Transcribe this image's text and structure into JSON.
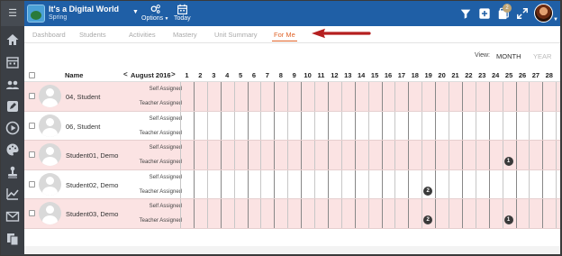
{
  "app": {
    "course_title": "It's a Digital World",
    "course_term": "Spring",
    "options_label": "Options",
    "today_label": "Today",
    "notification_count": "2"
  },
  "sidebar": {
    "items": [
      {
        "name": "home-icon"
      },
      {
        "name": "calendar-icon"
      },
      {
        "name": "users-icon"
      },
      {
        "name": "pencil-icon"
      },
      {
        "name": "play-icon"
      },
      {
        "name": "palette-icon"
      },
      {
        "name": "stamp-icon"
      },
      {
        "name": "chart-icon"
      },
      {
        "name": "mail-icon"
      },
      {
        "name": "pages-icon"
      }
    ]
  },
  "tabs": [
    {
      "label": "Dashboard",
      "active": false
    },
    {
      "label": "Students",
      "active": false
    },
    {
      "label": "Activities",
      "active": false
    },
    {
      "label": "Mastery",
      "active": false
    },
    {
      "label": "Unit Summary",
      "active": false
    },
    {
      "label": "For Me",
      "active": true
    }
  ],
  "view": {
    "label": "View:",
    "month": "MONTH",
    "year": "YEAR"
  },
  "grid": {
    "name_header": "Name",
    "month_label": "August 2016",
    "prev_label": "<",
    "next_label": ">",
    "days": [
      "1",
      "2",
      "3",
      "4",
      "5",
      "6",
      "7",
      "8",
      "9",
      "10",
      "11",
      "12",
      "13",
      "14",
      "15",
      "16",
      "17",
      "18",
      "19",
      "20",
      "21",
      "22",
      "23",
      "24",
      "25",
      "26",
      "27",
      "28"
    ],
    "self_label": "Self Assigned",
    "teacher_label": "Teacher Assigned",
    "students": [
      {
        "name": "04, Student",
        "badges": []
      },
      {
        "name": "06, Student",
        "badges": []
      },
      {
        "name": "Student01, Demo",
        "badges": [
          {
            "day": 25,
            "type": "teacher",
            "count": "1"
          }
        ]
      },
      {
        "name": "Student02, Demo",
        "badges": [
          {
            "day": 19,
            "type": "teacher",
            "count": "2"
          }
        ]
      },
      {
        "name": "Student03, Demo",
        "badges": [
          {
            "day": 19,
            "type": "teacher",
            "count": "2"
          },
          {
            "day": 25,
            "type": "teacher",
            "count": "1"
          }
        ]
      }
    ]
  },
  "colors": {
    "topbar": "#1f5fa6",
    "accent": "#e0642a",
    "row_highlight": "#fbe3e3",
    "arrow": "#b51f1f"
  }
}
